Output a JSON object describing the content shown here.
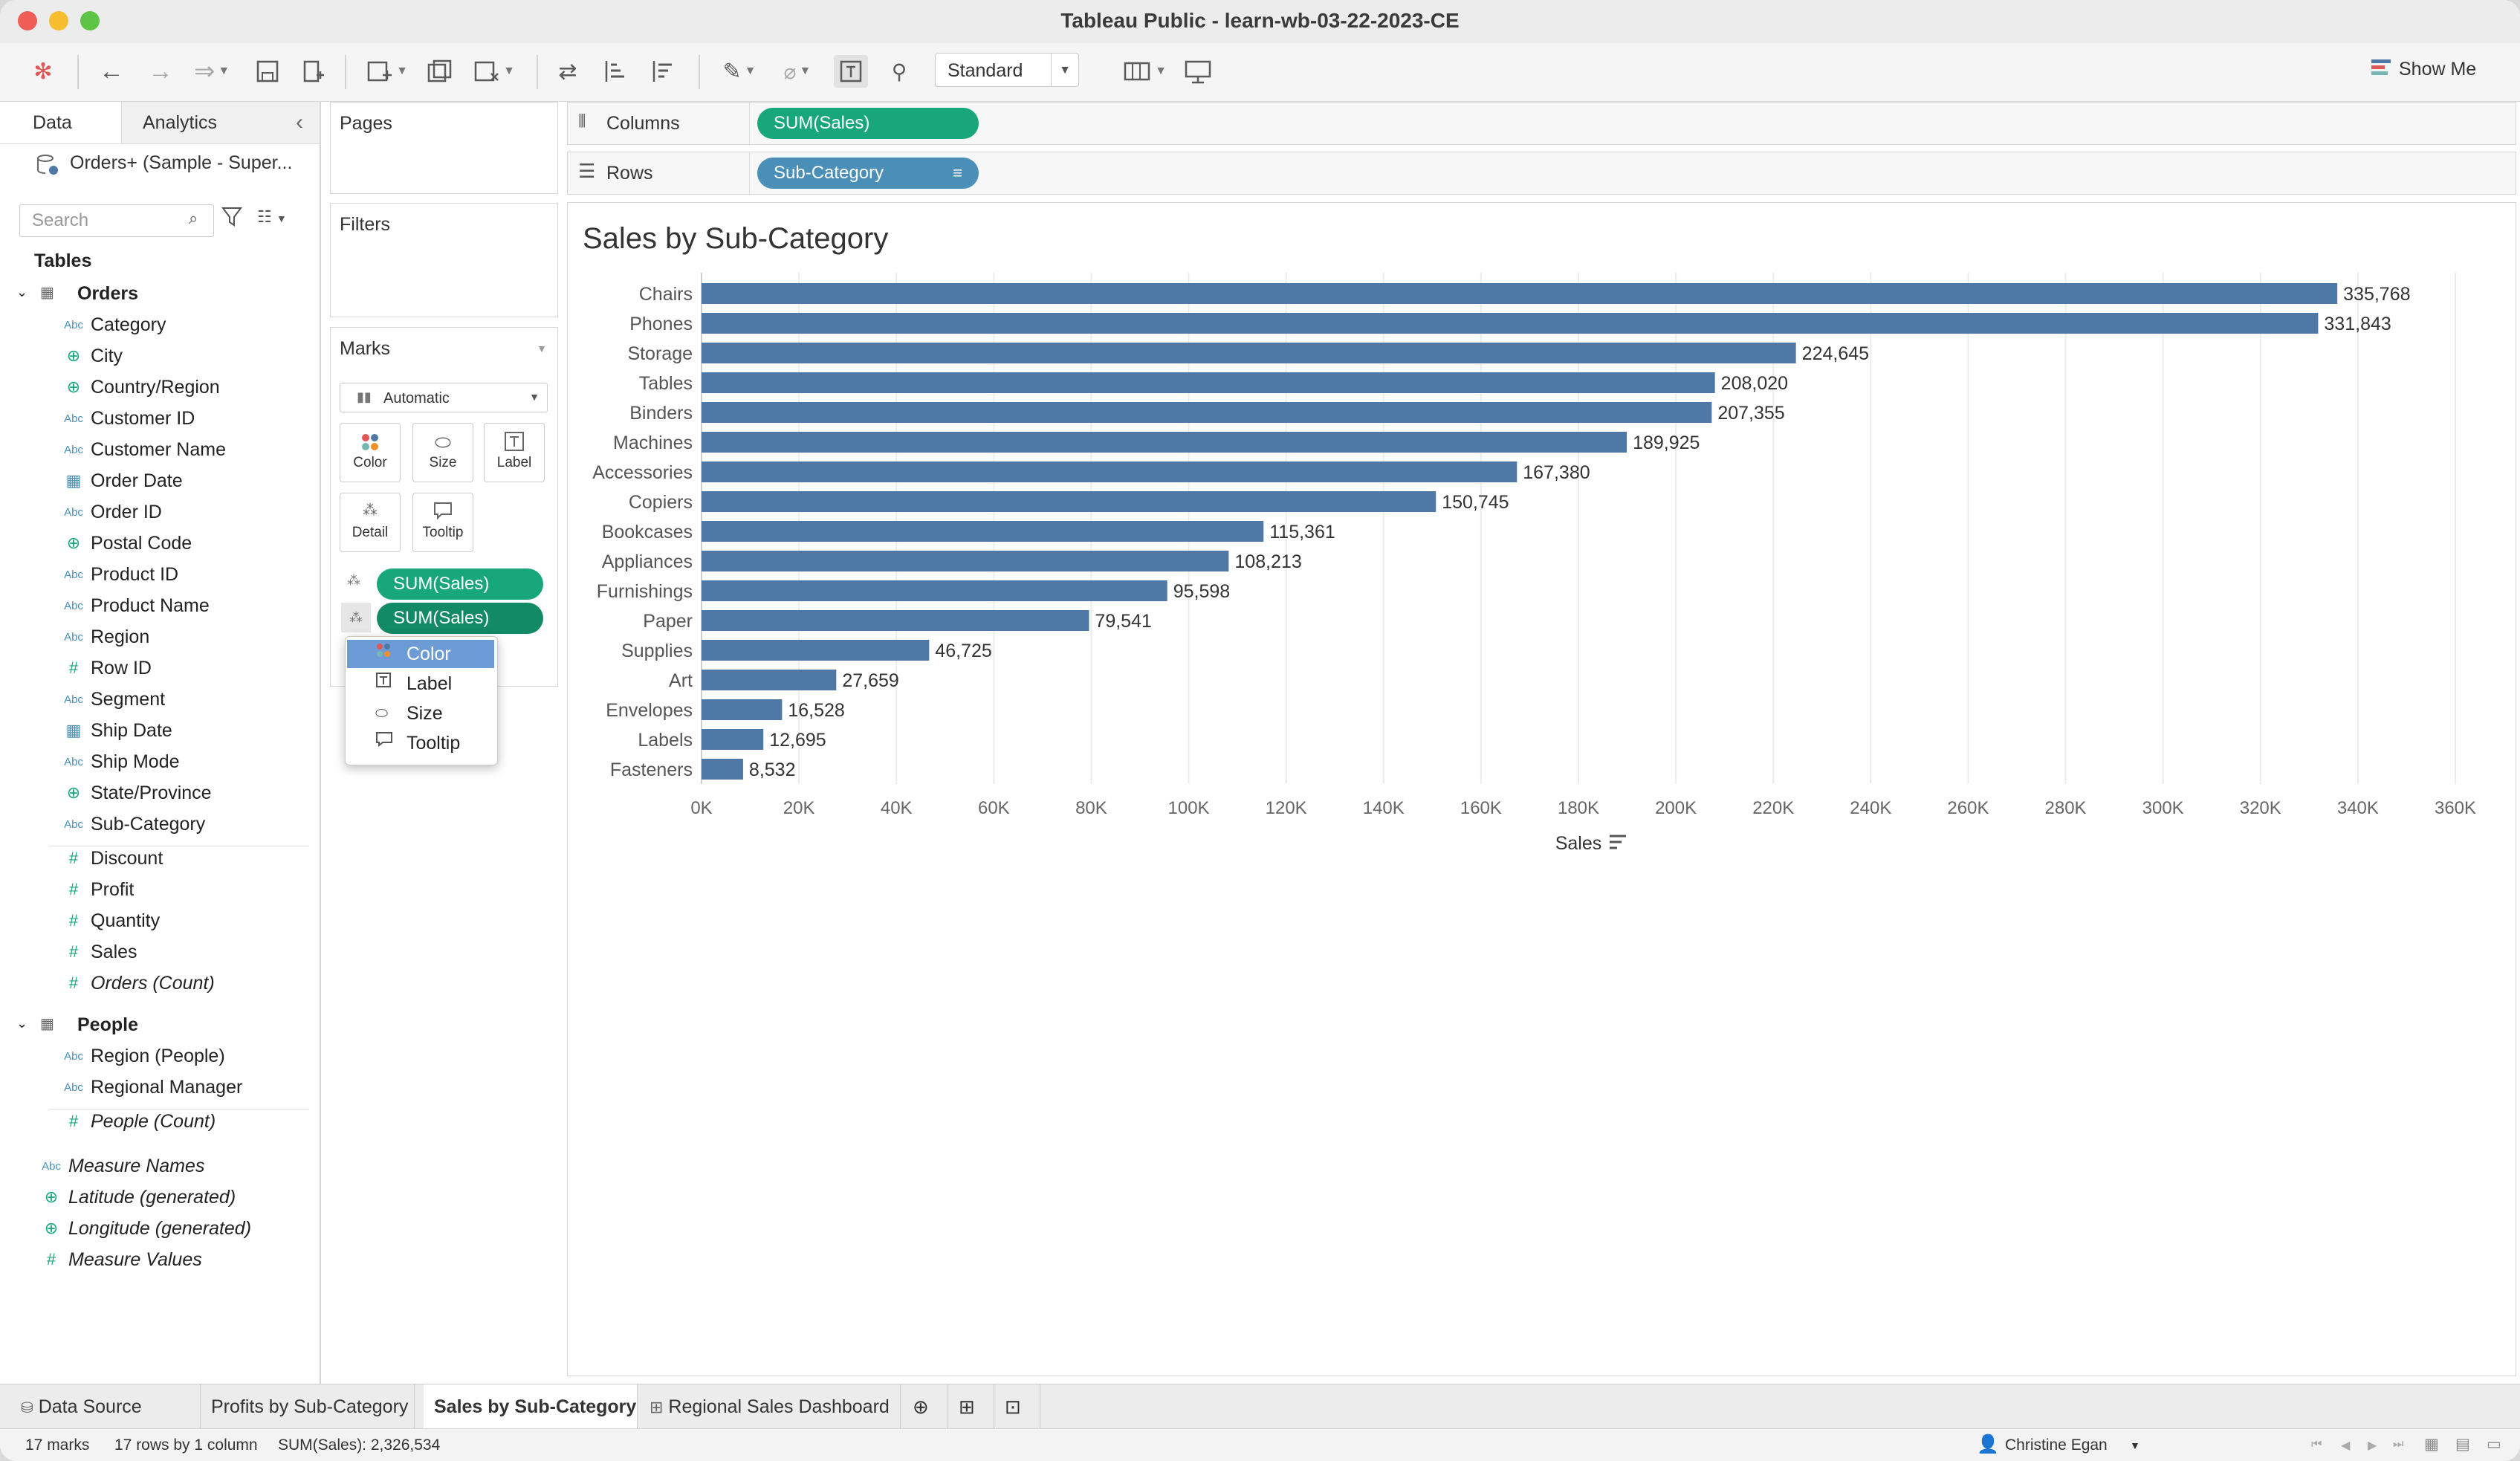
{
  "window": {
    "title": "Tableau Public - learn-wb-03-22-2023-CE"
  },
  "toolbar": {
    "view_size": "Standard",
    "show_me": "Show Me"
  },
  "left_pane": {
    "tabs": [
      "Data",
      "Analytics"
    ],
    "data_source": "Orders+ (Sample - Super...",
    "search_placeholder": "Search",
    "tables_heading": "Tables",
    "orders_table": "Orders",
    "orders_dimensions": [
      {
        "name": "Category",
        "type": "Abc"
      },
      {
        "name": "City",
        "type": "globe"
      },
      {
        "name": "Country/Region",
        "type": "globe"
      },
      {
        "name": "Customer ID",
        "type": "Abc"
      },
      {
        "name": "Customer Name",
        "type": "Abc"
      },
      {
        "name": "Order Date",
        "type": "date"
      },
      {
        "name": "Order ID",
        "type": "Abc"
      },
      {
        "name": "Postal Code",
        "type": "globe"
      },
      {
        "name": "Product ID",
        "type": "Abc"
      },
      {
        "name": "Product Name",
        "type": "Abc"
      },
      {
        "name": "Region",
        "type": "Abc"
      },
      {
        "name": "Row ID",
        "type": "#"
      },
      {
        "name": "Segment",
        "type": "Abc"
      },
      {
        "name": "Ship Date",
        "type": "date"
      },
      {
        "name": "Ship Mode",
        "type": "Abc"
      },
      {
        "name": "State/Province",
        "type": "globe"
      },
      {
        "name": "Sub-Category",
        "type": "Abc"
      }
    ],
    "orders_measures": [
      {
        "name": "Discount",
        "type": "#"
      },
      {
        "name": "Profit",
        "type": "#"
      },
      {
        "name": "Quantity",
        "type": "#"
      },
      {
        "name": "Sales",
        "type": "#"
      },
      {
        "name": "Orders (Count)",
        "type": "#",
        "italic": true
      }
    ],
    "people_table": "People",
    "people_fields": [
      {
        "name": "Region (People)",
        "type": "Abc"
      },
      {
        "name": "Regional Manager",
        "type": "Abc"
      },
      {
        "name": "People (Count)",
        "type": "#",
        "italic": true
      }
    ],
    "extra_fields": [
      {
        "name": "Measure Names",
        "type": "Abc",
        "italic": true
      },
      {
        "name": "Latitude (generated)",
        "type": "globe",
        "italic": true
      },
      {
        "name": "Longitude (generated)",
        "type": "globe",
        "italic": true
      },
      {
        "name": "Measure Values",
        "type": "#",
        "italic": true
      }
    ]
  },
  "shelves": {
    "pages": "Pages",
    "filters": "Filters",
    "columns_label": "Columns",
    "columns_pill": "SUM(Sales)",
    "rows_label": "Rows",
    "rows_pill": "Sub-Category"
  },
  "marks": {
    "title": "Marks",
    "type": "Automatic",
    "buttons": [
      "Color",
      "Size",
      "Label",
      "Detail",
      "Tooltip"
    ],
    "pills": [
      "SUM(Sales)",
      "SUM(Sales)"
    ],
    "popup_items": [
      "Color",
      "Label",
      "Size",
      "Tooltip"
    ]
  },
  "chart_data": {
    "type": "bar",
    "orientation": "horizontal",
    "title": "Sales by Sub-Category",
    "xlabel": "Sales",
    "ylabel": "",
    "categories": [
      "Chairs",
      "Phones",
      "Storage",
      "Tables",
      "Binders",
      "Machines",
      "Accessories",
      "Copiers",
      "Bookcases",
      "Appliances",
      "Furnishings",
      "Paper",
      "Supplies",
      "Art",
      "Envelopes",
      "Labels",
      "Fasteners"
    ],
    "values": [
      335768,
      331843,
      224645,
      208020,
      207355,
      189925,
      167380,
      150745,
      115361,
      108213,
      95598,
      79541,
      46725,
      27659,
      16528,
      12695,
      8532
    ],
    "value_labels": [
      "335,768",
      "331,843",
      "224,645",
      "208,020",
      "207,355",
      "189,925",
      "167,380",
      "150,745",
      "115,361",
      "108,213",
      "95,598",
      "79,541",
      "46,725",
      "27,659",
      "16,528",
      "12,695",
      "8,532"
    ],
    "xlim": [
      0,
      360000
    ],
    "xticks": [
      "0K",
      "20K",
      "40K",
      "60K",
      "80K",
      "100K",
      "120K",
      "140K",
      "160K",
      "180K",
      "200K",
      "220K",
      "240K",
      "260K",
      "280K",
      "300K",
      "320K",
      "340K",
      "360K"
    ],
    "bar_color": "#4e79a7",
    "grid": "vertical"
  },
  "sheet_tabs": [
    "Data Source",
    "Profits by Sub-Category",
    "Sales by Sub-Category",
    "Regional Sales Dashboard"
  ],
  "status": {
    "marks": "17 marks",
    "dims": "17 rows by 1 column",
    "sum": "SUM(Sales): 2,326,534",
    "user": "Christine Egan"
  }
}
